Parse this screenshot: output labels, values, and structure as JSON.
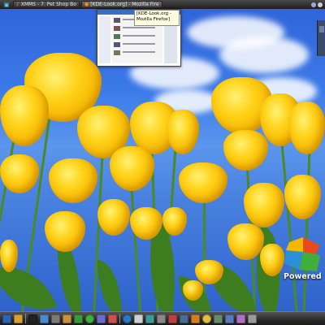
{
  "taskbar": {
    "tasks": [
      {
        "label": "XMMS - 7. Pet Shop Bo",
        "icon": "xmms-icon"
      },
      {
        "label": "[KDE-Look.org] - Mozilla Fire",
        "icon": "firefox-icon"
      }
    ]
  },
  "preview_tooltip": {
    "line1": "[KDE-Look.org -",
    "line2": "Mozilla Firefox]"
  },
  "desktop": {
    "powered_label": "Powered"
  },
  "dock": {
    "icons": [
      "kde-menu-icon",
      "home-folder-icon",
      "terminal-icon",
      "konqueror-icon",
      "system-settings-icon",
      "folder-icon",
      "media-player-icon",
      "chat-icon",
      "network-icon",
      "image-viewer-icon",
      "globe-icon",
      "mail-icon",
      "music-icon",
      "tools-icon",
      "calendar-icon",
      "screenshot-icon",
      "editor-icon",
      "clock-icon",
      "trash-icon",
      "display-icon",
      "sound-icon",
      "disk-icon"
    ]
  }
}
